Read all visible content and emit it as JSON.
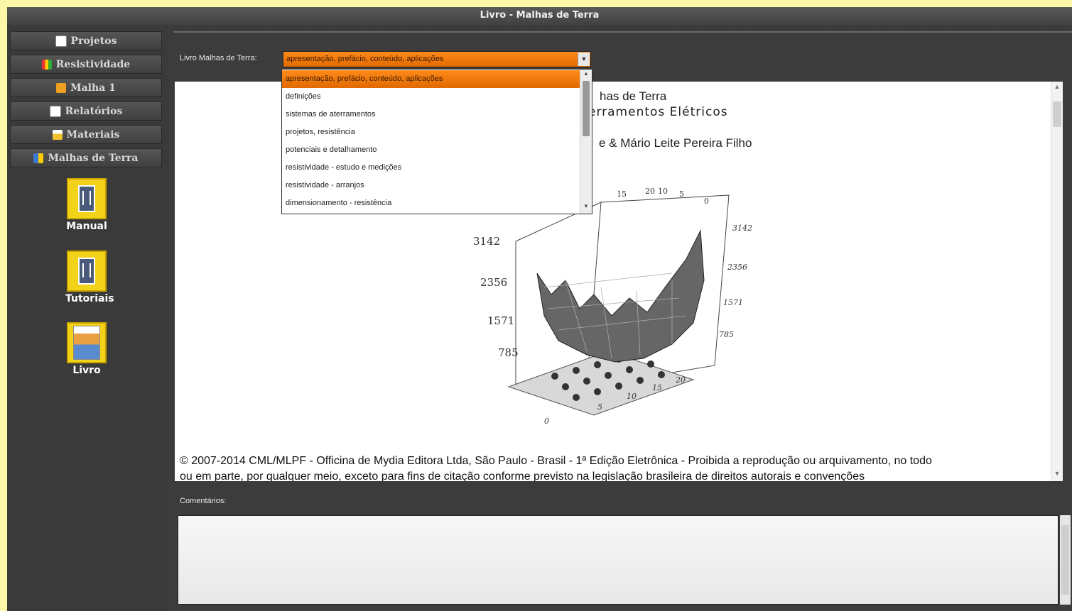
{
  "window": {
    "title": "Livro - Malhas de Terra"
  },
  "sidebar": {
    "buttons": [
      {
        "label": "Projetos",
        "icon": "folder-icon"
      },
      {
        "label": "Resistividade",
        "icon": "grid-icon"
      },
      {
        "label": "Malha 1",
        "icon": "mesh-icon"
      },
      {
        "label": "Relatórios",
        "icon": "report-icon"
      },
      {
        "label": "Materiais",
        "icon": "materials-icon"
      },
      {
        "label": "Malhas de Terra",
        "icon": "ground-mesh-icon"
      }
    ],
    "shortcuts": [
      {
        "label": "Manual",
        "icon": "manual-book-icon"
      },
      {
        "label": "Tutoriais",
        "icon": "tutorial-book-icon"
      },
      {
        "label": "Livro",
        "icon": "book-cover-icon"
      }
    ]
  },
  "chapter_select": {
    "label": "Livro Malhas de Terra:",
    "selected": "apresentação, prefácio, conteúdo, aplicações",
    "options": [
      "apresentação, prefácio, conteúdo, aplicações",
      "definições",
      "sistemas de aterramentos",
      "projetos, resistência",
      "potenciais e detalhamento",
      "resistividade - estudo e medições",
      "resistividade - arranjos",
      "dimensionamento - resistência"
    ]
  },
  "content": {
    "title_fragment": "has de Terra",
    "subtitle_fragment": "erramentos Elétricos",
    "authors_fragment": "e & Mário Leite Pereira Filho",
    "plot_ticks_z": [
      "3142",
      "2356",
      "1571",
      "785"
    ],
    "plot_ticks_right": [
      "3142",
      "2356",
      "1571",
      "785"
    ],
    "plot_ticks_top": [
      "20",
      "15",
      "20",
      "10",
      "5",
      "0"
    ],
    "plot_ticks_front": [
      "0",
      "5",
      "10",
      "15",
      "20"
    ],
    "copyright_line1": "© 2007-2014 CML/MLPF - Officina de Mydia Editora Ltda, São Paulo - Brasil - 1ª  Edição Eletrônica - Proibida a reprodução ou arquivamento, no todo",
    "copyright_line2": "ou em parte, por qualquer meio, exceto para fins de citação conforme previsto na legislação brasileira de direitos autorais e convenções"
  },
  "comments": {
    "label": "Comentários:",
    "value": ""
  },
  "colors": {
    "accent": "#f08010",
    "icon_frame": "#f3d21a",
    "background": "#3a3a3a",
    "outer": "#fdf7a8"
  }
}
